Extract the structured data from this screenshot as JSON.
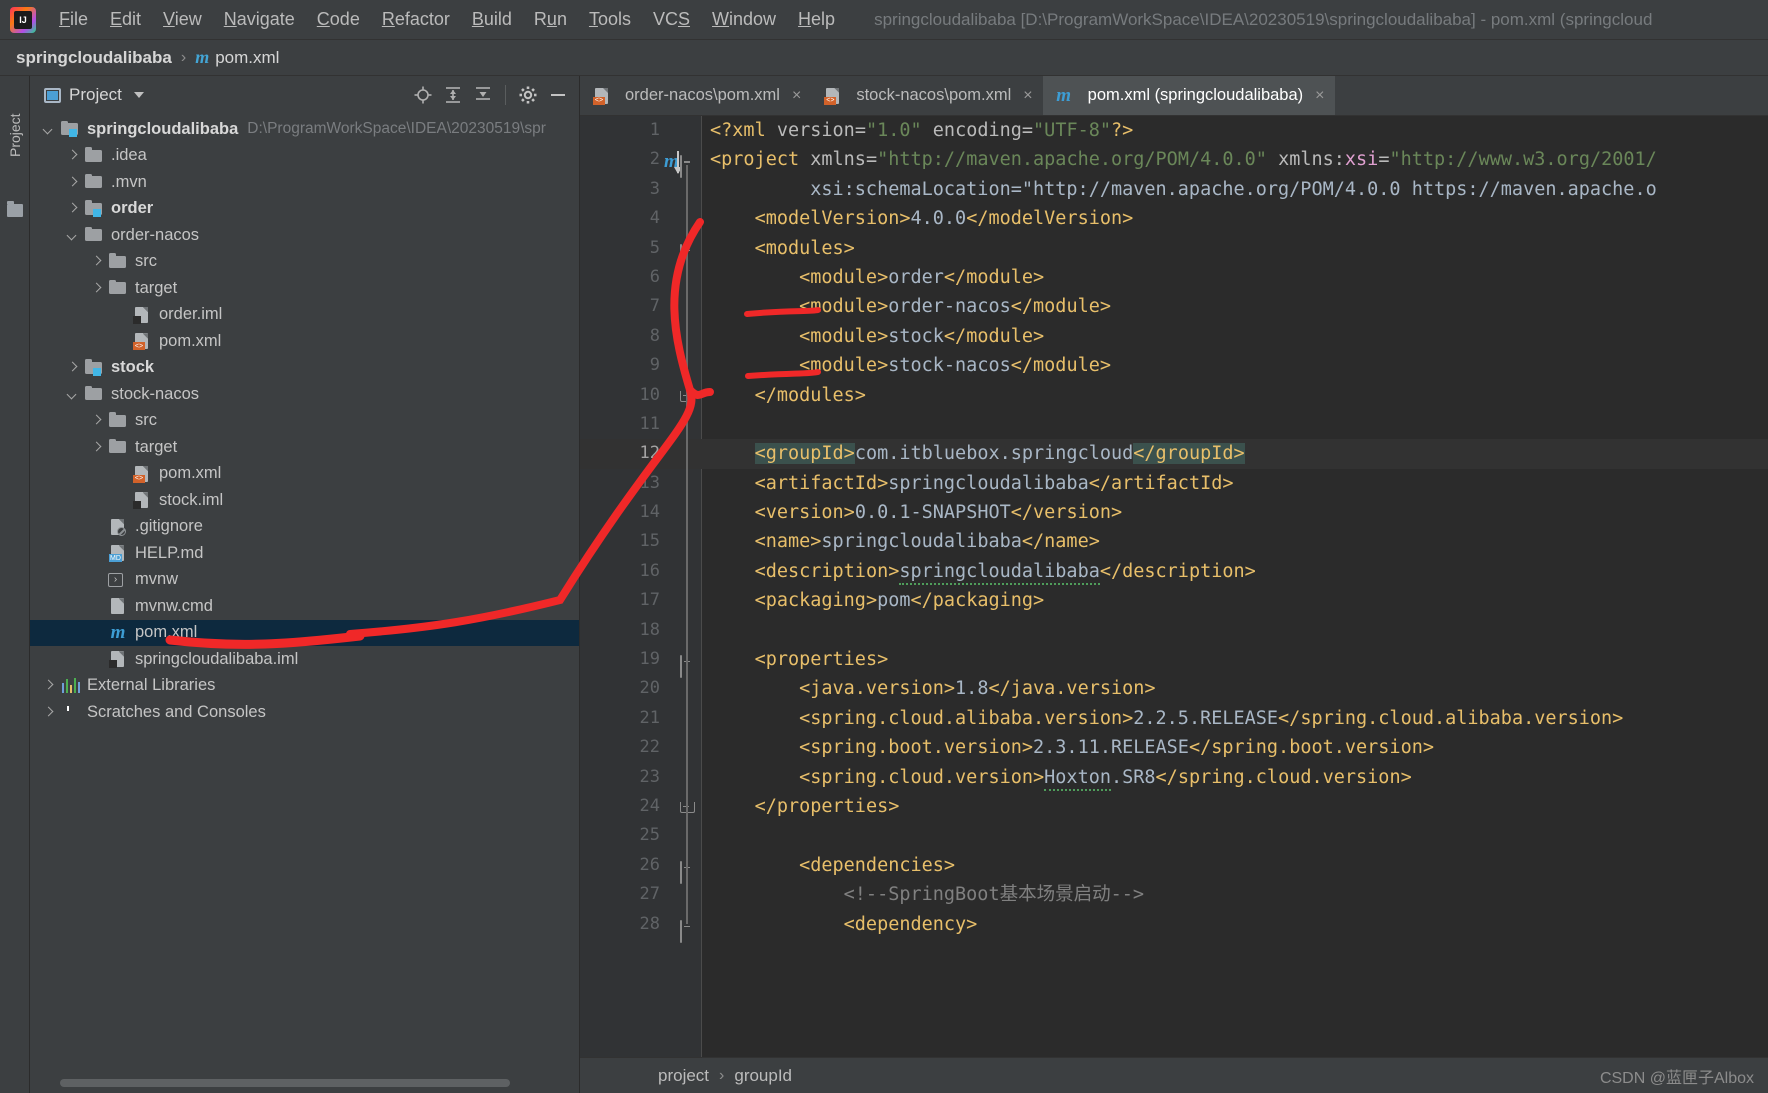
{
  "window": {
    "title": "springcloudalibaba [D:\\ProgramWorkSpace\\IDEA\\20230519\\springcloudalibaba] - pom.xml (springcloud",
    "logo_text": "IJ"
  },
  "menu": {
    "items": [
      {
        "label": "File",
        "mnemonic": "F"
      },
      {
        "label": "Edit",
        "mnemonic": "E"
      },
      {
        "label": "View",
        "mnemonic": "V"
      },
      {
        "label": "Navigate",
        "mnemonic": "N"
      },
      {
        "label": "Code",
        "mnemonic": "C"
      },
      {
        "label": "Refactor",
        "mnemonic": "R"
      },
      {
        "label": "Build",
        "mnemonic": "B"
      },
      {
        "label": "Run",
        "mnemonic": "u"
      },
      {
        "label": "Tools",
        "mnemonic": "T"
      },
      {
        "label": "VCS",
        "mnemonic": "S"
      },
      {
        "label": "Window",
        "mnemonic": "W"
      },
      {
        "label": "Help",
        "mnemonic": "H"
      }
    ]
  },
  "navbar": {
    "project": "springcloudalibaba",
    "separator": "›",
    "file": "pom.xml",
    "file_icon": "m"
  },
  "toolstrip": {
    "project_tab": "Project"
  },
  "project_panel": {
    "title": "Project",
    "tools": [
      "locate-icon",
      "expand-all-icon",
      "collapse-all-icon",
      "settings-icon",
      "hide-icon"
    ],
    "tree": [
      {
        "label": "springcloudalibaba",
        "path": "D:\\ProgramWorkSpace\\IDEA\\20230519\\spr",
        "indent": 0,
        "arrow": "down",
        "icon": "module",
        "bold": true
      },
      {
        "label": ".idea",
        "indent": 1,
        "arrow": "right",
        "icon": "folder",
        "bold": false
      },
      {
        "label": ".mvn",
        "indent": 1,
        "arrow": "right",
        "icon": "folder",
        "bold": false
      },
      {
        "label": "order",
        "indent": 1,
        "arrow": "right",
        "icon": "module",
        "bold": true
      },
      {
        "label": "order-nacos",
        "indent": 1,
        "arrow": "down",
        "icon": "folder",
        "bold": false
      },
      {
        "label": "src",
        "indent": 2,
        "arrow": "right",
        "icon": "folder",
        "bold": false
      },
      {
        "label": "target",
        "indent": 2,
        "arrow": "right",
        "icon": "folder",
        "bold": false
      },
      {
        "label": "order.iml",
        "indent": 3,
        "arrow": "none",
        "icon": "iml",
        "bold": false
      },
      {
        "label": "pom.xml",
        "indent": 3,
        "arrow": "none",
        "icon": "maven-xml",
        "bold": false
      },
      {
        "label": "stock",
        "indent": 1,
        "arrow": "right",
        "icon": "module",
        "bold": true
      },
      {
        "label": "stock-nacos",
        "indent": 1,
        "arrow": "down",
        "icon": "folder",
        "bold": false
      },
      {
        "label": "src",
        "indent": 2,
        "arrow": "right",
        "icon": "folder",
        "bold": false
      },
      {
        "label": "target",
        "indent": 2,
        "arrow": "right",
        "icon": "folder",
        "bold": false
      },
      {
        "label": "pom.xml",
        "indent": 3,
        "arrow": "none",
        "icon": "maven-xml",
        "bold": false
      },
      {
        "label": "stock.iml",
        "indent": 3,
        "arrow": "none",
        "icon": "iml",
        "bold": false
      },
      {
        "label": ".gitignore",
        "indent": 2,
        "arrow": "none",
        "icon": "gitignore",
        "bold": false
      },
      {
        "label": "HELP.md",
        "indent": 2,
        "arrow": "none",
        "icon": "markdown",
        "bold": false
      },
      {
        "label": "mvnw",
        "indent": 2,
        "arrow": "none",
        "icon": "script",
        "bold": false
      },
      {
        "label": "mvnw.cmd",
        "indent": 2,
        "arrow": "none",
        "icon": "cmd",
        "bold": false
      },
      {
        "label": "pom.xml",
        "indent": 2,
        "arrow": "none",
        "icon": "maven-blue",
        "bold": false,
        "selected": true
      },
      {
        "label": "springcloudalibaba.iml",
        "indent": 2,
        "arrow": "none",
        "icon": "iml",
        "bold": false
      },
      {
        "label": "External Libraries",
        "indent": 0,
        "arrow": "right",
        "icon": "libraries",
        "bold": false
      },
      {
        "label": "Scratches and Consoles",
        "indent": 0,
        "arrow": "right",
        "icon": "scratches",
        "bold": false
      }
    ]
  },
  "editor": {
    "tabs": [
      {
        "label": "order-nacos\\pom.xml",
        "icon": "maven-xml",
        "active": false,
        "close": "×"
      },
      {
        "label": "stock-nacos\\pom.xml",
        "icon": "maven-xml",
        "active": false,
        "close": "×"
      },
      {
        "label": "pom.xml (springcloudalibaba)",
        "icon": "maven-blue",
        "active": true,
        "close": "×"
      }
    ],
    "caret_line": 12,
    "lines": [
      {
        "n": 1,
        "text": "<?xml version=\"1.0\" encoding=\"UTF-8\"?>"
      },
      {
        "n": 2,
        "text": "<project xmlns=\"http://maven.apache.org/POM/4.0.0\" xmlns:xsi=\"http://www.w3.org/2001/"
      },
      {
        "n": 3,
        "text": "         xsi:schemaLocation=\"http://maven.apache.org/POM/4.0.0 https://maven.apache.o"
      },
      {
        "n": 4,
        "text": "    <modelVersion>4.0.0</modelVersion>"
      },
      {
        "n": 5,
        "text": "    <modules>"
      },
      {
        "n": 6,
        "text": "        <module>order</module>"
      },
      {
        "n": 7,
        "text": "        <module>order-nacos</module>"
      },
      {
        "n": 8,
        "text": "        <module>stock</module>"
      },
      {
        "n": 9,
        "text": "        <module>stock-nacos</module>"
      },
      {
        "n": 10,
        "text": "    </modules>"
      },
      {
        "n": 11,
        "text": ""
      },
      {
        "n": 12,
        "text": "    <groupId>com.itbluebox.springcloud</groupId>"
      },
      {
        "n": 13,
        "text": "    <artifactId>springcloudalibaba</artifactId>"
      },
      {
        "n": 14,
        "text": "    <version>0.0.1-SNAPSHOT</version>"
      },
      {
        "n": 15,
        "text": "    <name>springcloudalibaba</name>"
      },
      {
        "n": 16,
        "text": "    <description>springcloudalibaba</description>"
      },
      {
        "n": 17,
        "text": "    <packaging>pom</packaging>"
      },
      {
        "n": 18,
        "text": ""
      },
      {
        "n": 19,
        "text": "    <properties>"
      },
      {
        "n": 20,
        "text": "        <java.version>1.8</java.version>"
      },
      {
        "n": 21,
        "text": "        <spring.cloud.alibaba.version>2.2.5.RELEASE</spring.cloud.alibaba.version>"
      },
      {
        "n": 22,
        "text": "        <spring.boot.version>2.3.11.RELEASE</spring.boot.version>"
      },
      {
        "n": 23,
        "text": "        <spring.cloud.version>Hoxton.SR8</spring.cloud.version>"
      },
      {
        "n": 24,
        "text": "    </properties>"
      },
      {
        "n": 25,
        "text": ""
      },
      {
        "n": 26,
        "text": "        <dependencies>"
      },
      {
        "n": 27,
        "text": "            <!--SpringBoot基本场景启动-->"
      },
      {
        "n": 28,
        "text": "            <dependency>"
      }
    ]
  },
  "breadcrumb": {
    "items": [
      "project",
      "groupId"
    ],
    "separator": "›"
  },
  "watermark": "CSDN @蓝匣子Albox",
  "colors": {
    "accent_blue": "#4b9fd5",
    "maven_orange": "#d2622a",
    "selection_blue": "#0d293e",
    "annotation_red": "#f02828",
    "tag_yellow": "#e8bf6a",
    "string_green": "#6a8759",
    "text_blue_gray": "#a9b7c6"
  }
}
